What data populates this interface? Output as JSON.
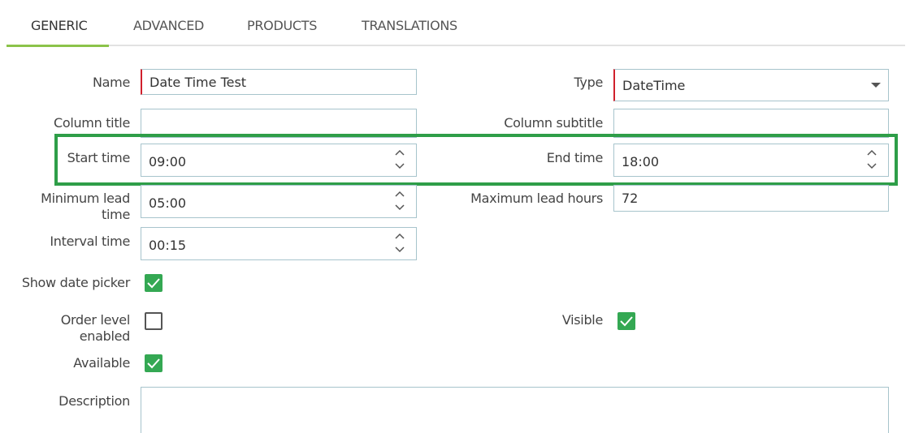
{
  "tabs": [
    {
      "label": "GENERIC",
      "active": true
    },
    {
      "label": "ADVANCED",
      "active": false
    },
    {
      "label": "PRODUCTS",
      "active": false
    },
    {
      "label": "TRANSLATIONS",
      "active": false
    }
  ],
  "form": {
    "name": {
      "label": "Name",
      "value": "Date Time Test"
    },
    "type": {
      "label": "Type",
      "value": "DateTime"
    },
    "column_title": {
      "label": "Column title",
      "value": ""
    },
    "column_subtitle": {
      "label": "Column subtitle",
      "value": ""
    },
    "start_time": {
      "label": "Start time",
      "value": "09:00"
    },
    "end_time": {
      "label": "End time",
      "value": "18:00"
    },
    "minimum_lead_time": {
      "label_line1": "Minimum lead",
      "label_line2": "time",
      "value": "05:00"
    },
    "maximum_lead_hours": {
      "label": "Maximum lead hours",
      "value": "72"
    },
    "interval_time": {
      "label": "Interval time",
      "value": "00:15"
    },
    "show_date_picker": {
      "label": "Show date picker",
      "checked": true
    },
    "order_level_enabled": {
      "label_line1": "Order level",
      "label_line2": "enabled",
      "checked": false
    },
    "visible": {
      "label": "Visible",
      "checked": true
    },
    "available": {
      "label": "Available",
      "checked": true
    },
    "description": {
      "label": "Description",
      "value": ""
    }
  },
  "colors": {
    "accent": "#8bc34a",
    "required": "#d0202c",
    "checkbox": "#34a853",
    "highlight": "#2e9e48"
  }
}
